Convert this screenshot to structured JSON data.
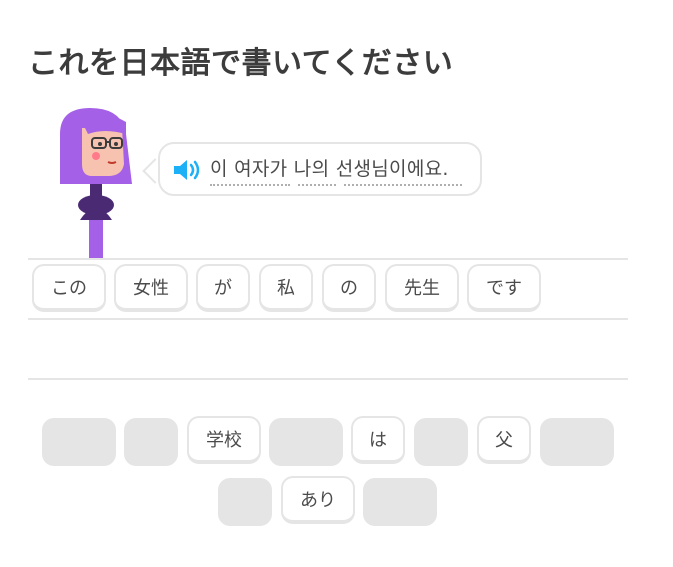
{
  "title": "これを日本語で書いてください",
  "prompt": {
    "sentence": "이 여자가 나의 선생님이에요.",
    "speaker_icon": "speaker-icon",
    "accent_color": "#1cb0f6"
  },
  "answer_tiles": [
    {
      "label": "この"
    },
    {
      "label": "女性"
    },
    {
      "label": "が"
    },
    {
      "label": "私"
    },
    {
      "label": "の"
    },
    {
      "label": "先生"
    },
    {
      "label": "です"
    }
  ],
  "word_bank": {
    "row1": [
      {
        "label": "",
        "used": true
      },
      {
        "label": "",
        "used": true
      },
      {
        "label": "学校",
        "used": false
      },
      {
        "label": "",
        "used": true
      },
      {
        "label": "は",
        "used": false
      },
      {
        "label": "",
        "used": true
      },
      {
        "label": "父",
        "used": false
      },
      {
        "label": "",
        "used": true
      }
    ],
    "row2": [
      {
        "label": "",
        "used": true
      },
      {
        "label": "あり",
        "used": false
      },
      {
        "label": "",
        "used": true
      }
    ]
  },
  "colors": {
    "border": "#e5e5e5",
    "text": "#4b4b4b",
    "character_hair": "#a560e8"
  }
}
